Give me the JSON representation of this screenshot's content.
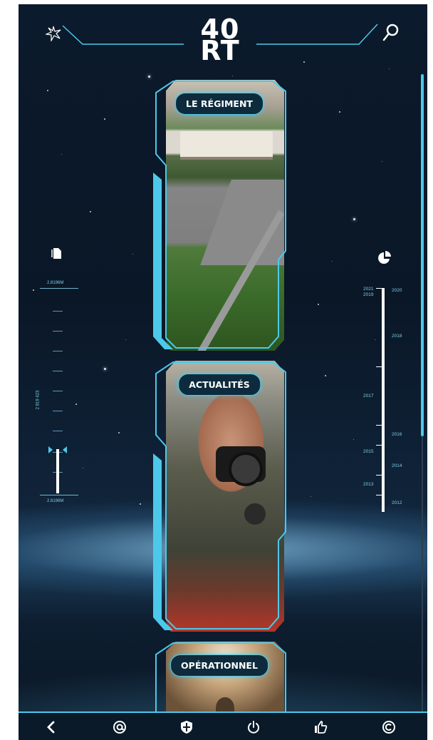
{
  "header": {
    "logo_top": "40",
    "logo_bottom": "RT"
  },
  "cards": [
    {
      "label": "LE RÉGIMENT"
    },
    {
      "label": "ACTUALITÉS"
    },
    {
      "label": "OPÉRATIONNEL"
    }
  ],
  "left_gauge": {
    "top_value": "2.8196M",
    "mid_value": "2 819 423",
    "bottom_value": "2.8196M"
  },
  "timeline": {
    "years_left": [
      "2021",
      "2019",
      "2017",
      "2015",
      "2013"
    ],
    "years_right": [
      "2020",
      "2018",
      "2016",
      "2014",
      "2012"
    ]
  },
  "bottom_nav": {
    "items": [
      "back-icon",
      "at-icon",
      "shield-icon",
      "power-icon",
      "thumbs-up-icon",
      "copyright-icon"
    ]
  },
  "colors": {
    "accent": "#4cc9ea",
    "background": "#0a1727"
  }
}
